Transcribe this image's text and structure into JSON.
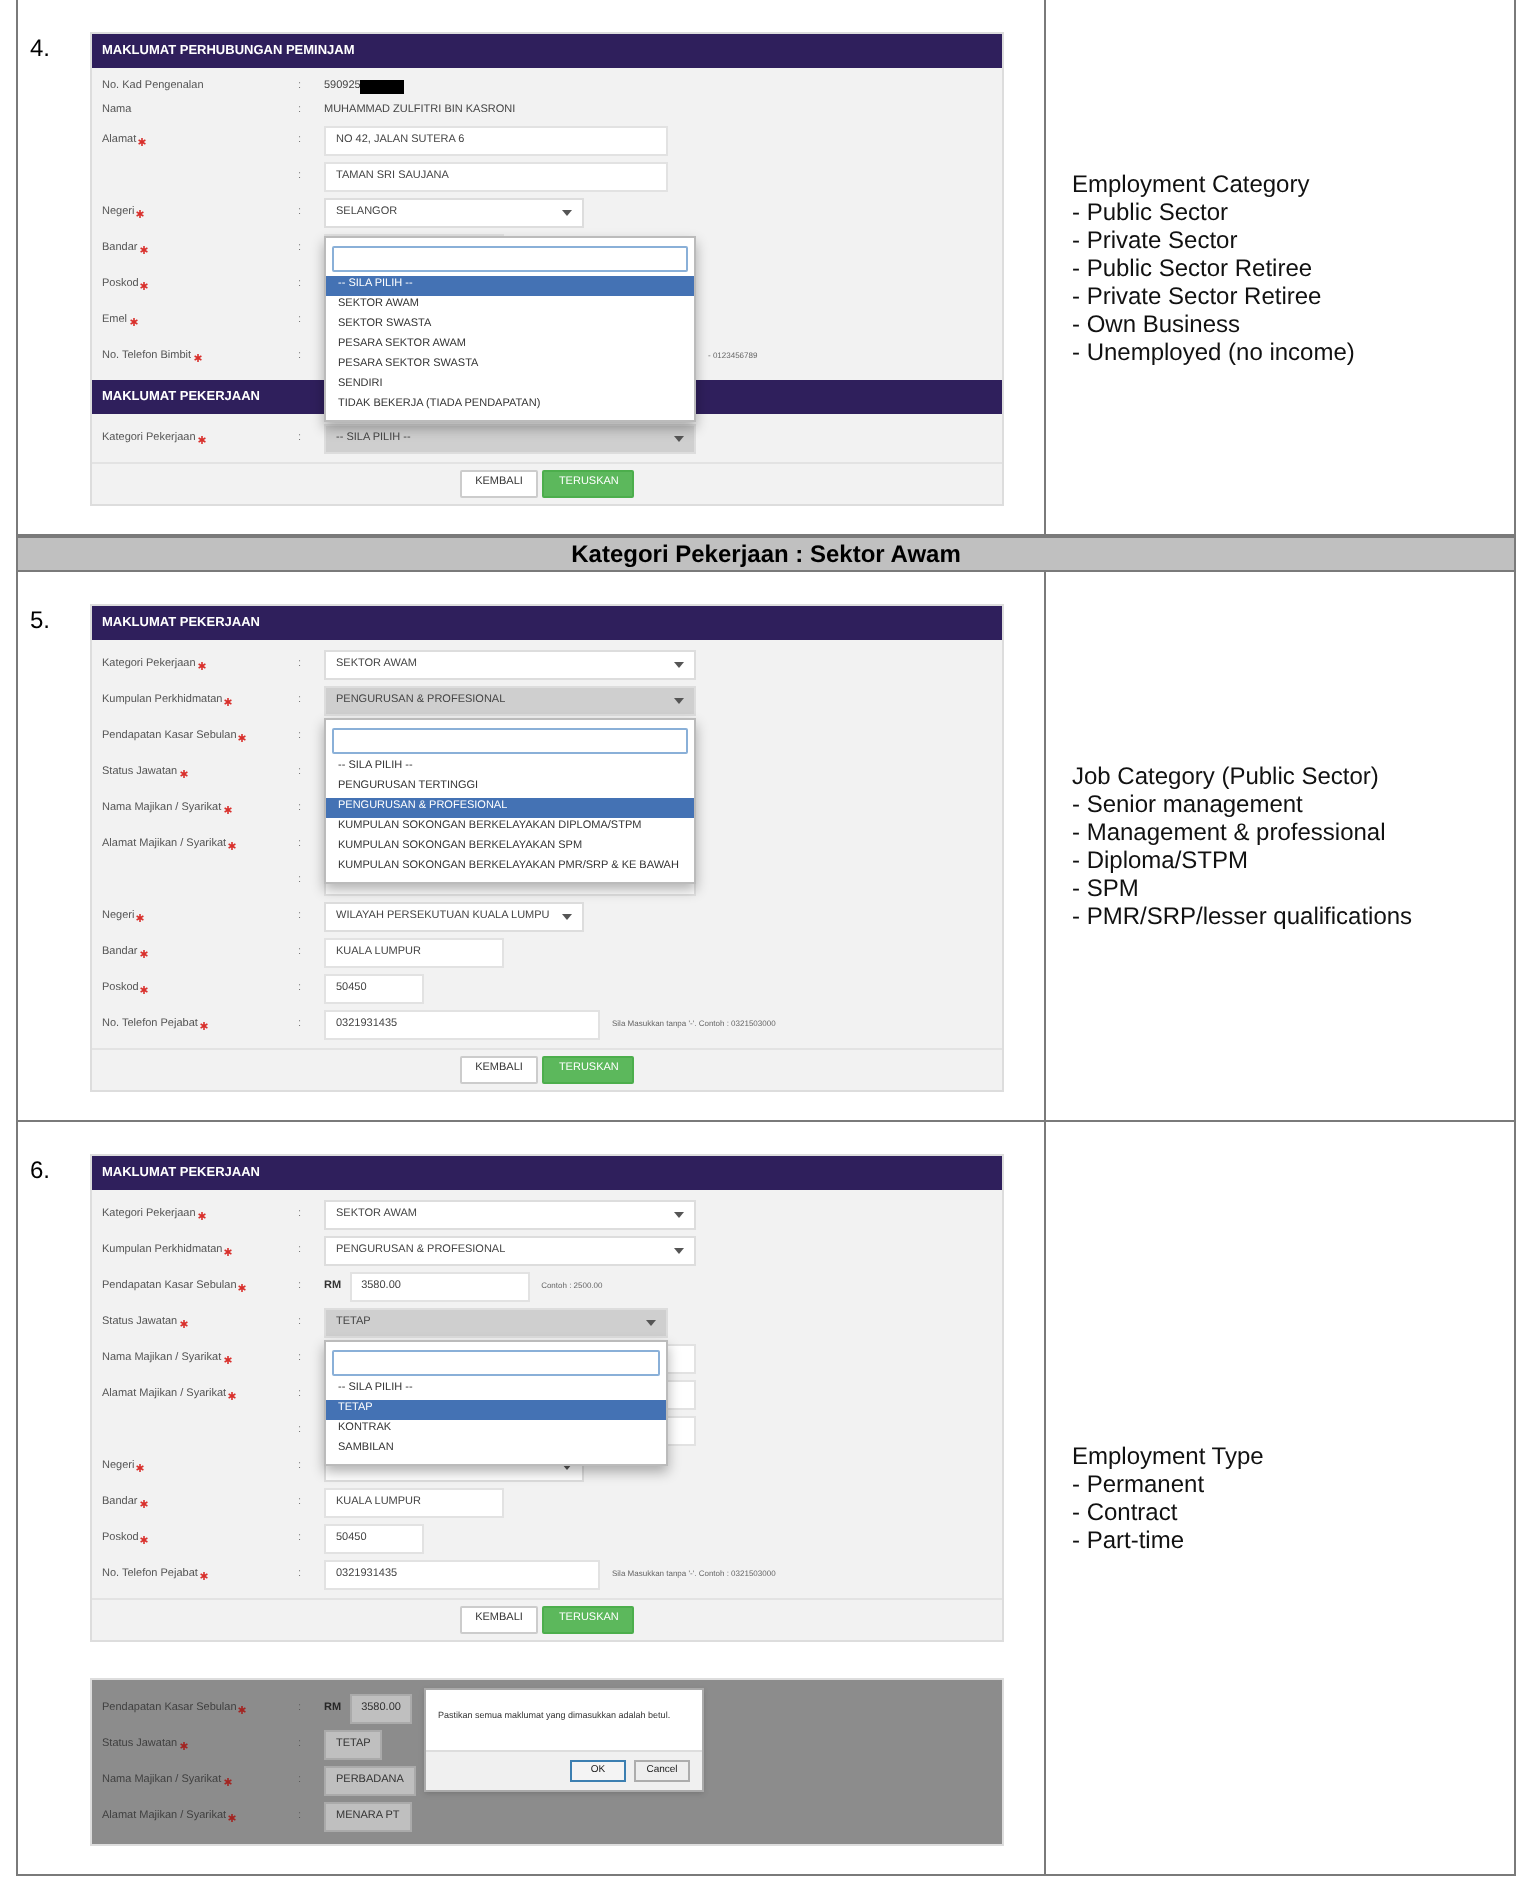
{
  "rows": [
    {
      "kind": "step",
      "number": "4.",
      "screens": [
        {
          "sections": [
            {
              "title": "MAKLUMAT PERHUBUNGAN PEMINJAM",
              "fields": [
                {
                  "label": "No. Kad Pengenalan",
                  "required": false,
                  "colon": ":",
                  "kind": "text",
                  "value": "590925",
                  "redacted": true
                },
                {
                  "label": "Nama",
                  "required": false,
                  "colon": ":",
                  "kind": "text",
                  "value": "MUHAMMAD ZULFITRI BIN KASRONI"
                },
                {
                  "label": "Alamat",
                  "required": true,
                  "colon": ":",
                  "kind": "input",
                  "value": "NO 42, JALAN SUTERA 6"
                },
                {
                  "colon": ":",
                  "kind": "input",
                  "value": "TAMAN SRI SAUJANA"
                },
                {
                  "label": "Negeri",
                  "required": true,
                  "colon": ":",
                  "kind": "select",
                  "value": "SELANGOR"
                },
                {
                  "label": "Bandar",
                  "required": true,
                  "colon": ":",
                  "kind": "input"
                },
                {
                  "label": "Poskod",
                  "required": true,
                  "colon": ":",
                  "kind": "input"
                },
                {
                  "label": "Emel",
                  "required": true,
                  "colon": ":",
                  "kind": "input"
                },
                {
                  "label": "No. Telefon Bimbit",
                  "required": true,
                  "colon": ":",
                  "kind": "input",
                  "hint": "- 0123456789"
                }
              ]
            },
            {
              "title": "MAKLUMAT PEKERJAAN",
              "fields": [
                {
                  "label": "Kategori Pekerjaan",
                  "required": true,
                  "colon": ":",
                  "kind": "select",
                  "value": "-- SILA PILIH --",
                  "open": true,
                  "opens_up": true,
                  "options": [
                    {
                      "label": "-- SILA PILIH --",
                      "selected": true
                    },
                    {
                      "label": "SEKTOR AWAM",
                      "selected": false
                    },
                    {
                      "label": "SEKTOR SWASTA",
                      "selected": false
                    },
                    {
                      "label": "PESARA SEKTOR AWAM",
                      "selected": false
                    },
                    {
                      "label": "PESARA SEKTOR SWASTA",
                      "selected": false
                    },
                    {
                      "label": "SENDIRI",
                      "selected": false
                    },
                    {
                      "label": "TIDAK BEKERJA (TIADA PENDAPATAN)",
                      "selected": false
                    }
                  ]
                }
              ]
            }
          ],
          "buttons": [
            {
              "label": "KEMBALI",
              "kind": "default"
            },
            {
              "label": "TERUSKAN",
              "kind": "primary"
            }
          ]
        }
      ],
      "notes": {
        "title": "Employment Category",
        "items": [
          "- Public Sector",
          "- Private Sector",
          "- Public Sector Retiree",
          "- Private Sector Retiree",
          "- Own Business",
          "- Unemployed (no income)"
        ]
      }
    },
    {
      "kind": "heading",
      "text": "Kategori Pekerjaan : Sektor Awam"
    },
    {
      "kind": "step",
      "number": "5.",
      "screens": [
        {
          "sections": [
            {
              "title": "MAKLUMAT PEKERJAAN",
              "fields": [
                {
                  "label": "Kategori Pekerjaan",
                  "required": true,
                  "colon": ":",
                  "kind": "select",
                  "value": "SEKTOR AWAM"
                },
                {
                  "label": "Kumpulan Perkhidmatan",
                  "required": true,
                  "colon": ":",
                  "kind": "select",
                  "value": "PENGURUSAN & PROFESIONAL",
                  "open": true,
                  "opens_up": false,
                  "options": [
                    {
                      "label": "-- SILA PILIH --",
                      "selected": false
                    },
                    {
                      "label": "PENGURUSAN TERTINGGI",
                      "selected": false
                    },
                    {
                      "label": "PENGURUSAN & PROFESIONAL",
                      "selected": true
                    },
                    {
                      "label": "KUMPULAN SOKONGAN BERKELAYAKAN DIPLOMA/STPM",
                      "selected": false
                    },
                    {
                      "label": "KUMPULAN SOKONGAN BERKELAYAKAN SPM",
                      "selected": false
                    },
                    {
                      "label": "KUMPULAN SOKONGAN BERKELAYAKAN PMR/SRP & KE BAWAH",
                      "selected": false
                    }
                  ]
                },
                {
                  "label": "Pendapatan Kasar Sebulan",
                  "required": true,
                  "colon": ":",
                  "kind": "input"
                },
                {
                  "label": "Status Jawatan",
                  "required": true,
                  "colon": ":",
                  "kind": "input"
                },
                {
                  "label": "Nama Majikan / Syarikat",
                  "required": true,
                  "colon": ":",
                  "kind": "input"
                },
                {
                  "label": "Alamat Majikan / Syarikat",
                  "required": true,
                  "colon": ":",
                  "kind": "input"
                },
                {
                  "colon": ":",
                  "kind": "input"
                },
                {
                  "label": "Negeri",
                  "required": true,
                  "colon": ":",
                  "kind": "select",
                  "value": "WILAYAH PERSEKUTUAN KUALA LUMPU"
                },
                {
                  "label": "Bandar",
                  "required": true,
                  "colon": ":",
                  "kind": "input",
                  "value": "KUALA LUMPUR"
                },
                {
                  "label": "Poskod",
                  "required": true,
                  "colon": ":",
                  "kind": "input",
                  "value": "50450"
                },
                {
                  "label": "No. Telefon Pejabat",
                  "required": true,
                  "colon": ":",
                  "kind": "input",
                  "value": "0321931435",
                  "hint": "Sila Masukkan tanpa '-'. Contoh : 0321503000"
                }
              ]
            }
          ],
          "buttons": [
            {
              "label": "KEMBALI",
              "kind": "default"
            },
            {
              "label": "TERUSKAN",
              "kind": "primary"
            }
          ]
        }
      ],
      "notes": {
        "title": "Job Category (Public Sector)",
        "items": [
          "- Senior management",
          "- Management & professional",
          "- Diploma/STPM",
          "- SPM",
          "- PMR/SRP/lesser qualifications"
        ]
      }
    },
    {
      "kind": "step",
      "number": "6.",
      "screens": [
        {
          "sections": [
            {
              "title": "MAKLUMAT PEKERJAAN",
              "fields": [
                {
                  "label": "Kategori Pekerjaan",
                  "required": true,
                  "colon": ":",
                  "kind": "select",
                  "value": "SEKTOR AWAM"
                },
                {
                  "label": "Kumpulan Perkhidmatan",
                  "required": true,
                  "colon": ":",
                  "kind": "select",
                  "value": "PENGURUSAN & PROFESIONAL"
                },
                {
                  "label": "Pendapatan Kasar Sebulan",
                  "required": true,
                  "colon": ":",
                  "kind": "money",
                  "prefix": "RM",
                  "value": "3580.00",
                  "hint": "Contoh : 2500.00"
                },
                {
                  "label": "Status Jawatan",
                  "required": true,
                  "colon": ":",
                  "kind": "select",
                  "value": "TETAP",
                  "open": true,
                  "opens_up": false,
                  "options": [
                    {
                      "label": "-- SILA PILIH --",
                      "selected": false
                    },
                    {
                      "label": "TETAP",
                      "selected": true
                    },
                    {
                      "label": "KONTRAK",
                      "selected": false
                    },
                    {
                      "label": "SAMBILAN",
                      "selected": false
                    }
                  ]
                },
                {
                  "label": "Nama Majikan / Syarikat",
                  "required": true,
                  "colon": ":",
                  "kind": "input"
                },
                {
                  "label": "Alamat Majikan / Syarikat",
                  "required": true,
                  "colon": ":",
                  "kind": "input"
                },
                {
                  "colon": ":",
                  "kind": "input"
                },
                {
                  "label": "Negeri",
                  "required": true,
                  "colon": ":",
                  "kind": "select"
                },
                {
                  "label": "Bandar",
                  "required": true,
                  "colon": ":",
                  "kind": "input",
                  "value": "KUALA LUMPUR"
                },
                {
                  "label": "Poskod",
                  "required": true,
                  "colon": ":",
                  "kind": "input",
                  "value": "50450"
                },
                {
                  "label": "No. Telefon Pejabat",
                  "required": true,
                  "colon": ":",
                  "kind": "input",
                  "value": "0321931435",
                  "hint": "Sila Masukkan tanpa '-'. Contoh : 0321503000"
                }
              ]
            }
          ],
          "buttons": [
            {
              "label": "KEMBALI",
              "kind": "default"
            },
            {
              "label": "TERUSKAN",
              "kind": "primary"
            }
          ]
        },
        {
          "dimmed": true,
          "sections": [
            {
              "fields": [
                {
                  "label": "Pendapatan Kasar Sebulan",
                  "required": true,
                  "colon": ":",
                  "kind": "money",
                  "prefix": "RM",
                  "value": "3580.00"
                },
                {
                  "label": "Status Jawatan",
                  "required": true,
                  "colon": ":",
                  "kind": "input",
                  "value": "TETAP"
                },
                {
                  "label": "Nama Majikan / Syarikat",
                  "required": true,
                  "colon": ":",
                  "kind": "input",
                  "value": "PERBADANA"
                },
                {
                  "label": "Alamat Majikan / Syarikat",
                  "required": true,
                  "colon": ":",
                  "kind": "input",
                  "value": "MENARA PT"
                }
              ]
            }
          ],
          "dialog": {
            "message": "Pastikan semua maklumat yang dimasukkan adalah betul.",
            "buttons": [
              {
                "label": "OK",
                "kind": "primary"
              },
              {
                "label": "Cancel",
                "kind": "default"
              }
            ]
          }
        }
      ],
      "notes": {
        "title": "Employment Type",
        "items": [
          "- Permanent",
          "- Contract",
          "- Part-time"
        ]
      }
    }
  ]
}
